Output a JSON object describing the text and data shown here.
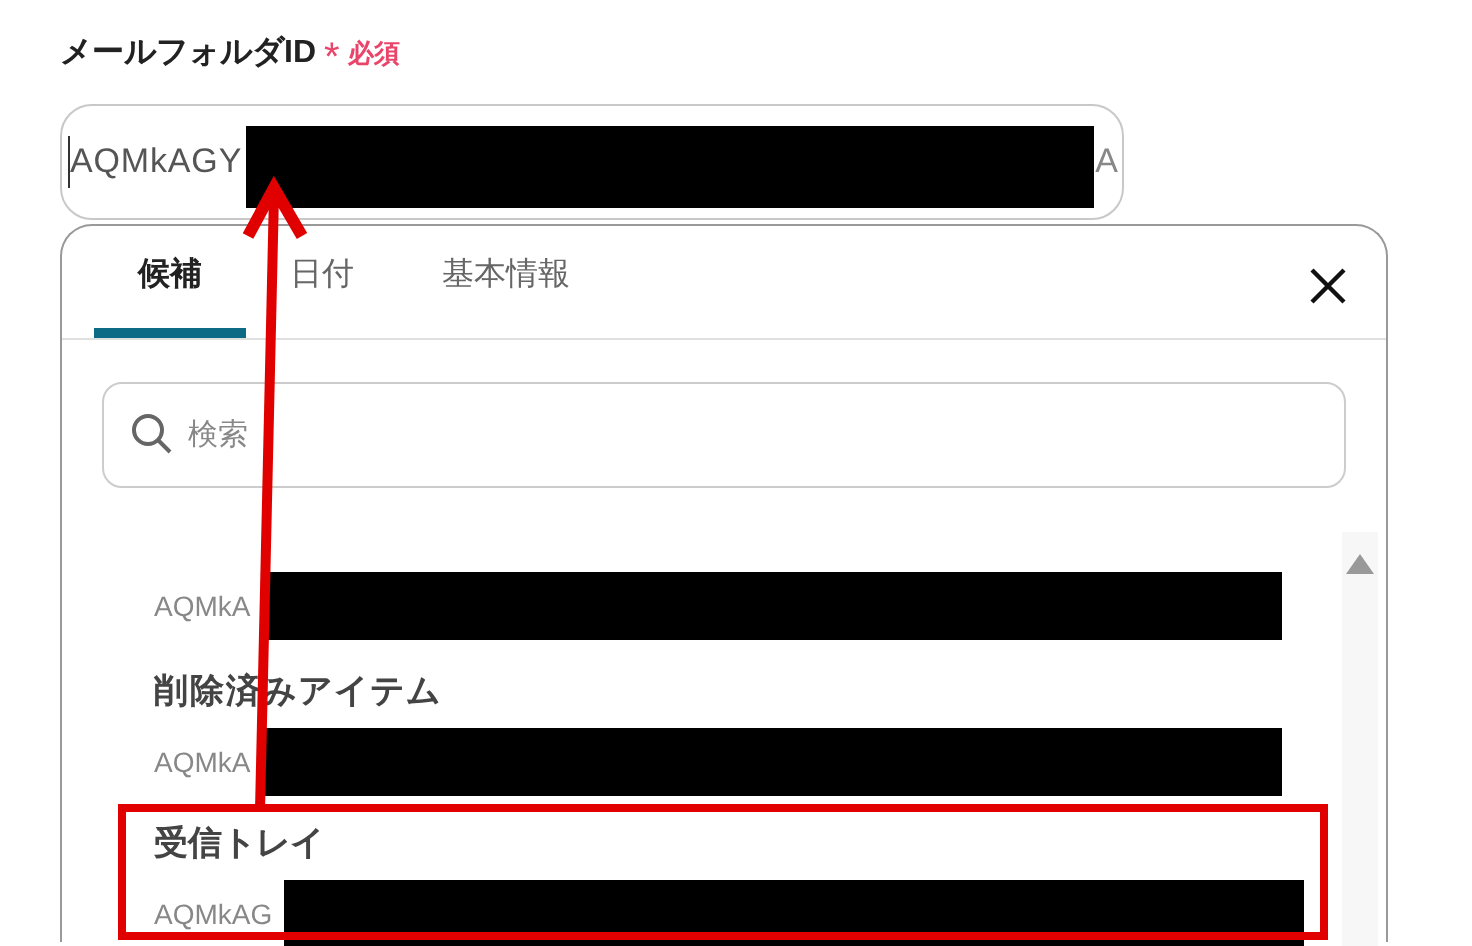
{
  "field": {
    "label": "メールフォルダID",
    "required_mark": "*",
    "required_text": "必須",
    "value_start": "AQMkAGY",
    "value_end": "A",
    "redacted": true
  },
  "dropdown": {
    "tabs": [
      {
        "label": "候補",
        "selected": true
      },
      {
        "label": "日付",
        "selected": false
      },
      {
        "label": "基本情報",
        "selected": false
      }
    ],
    "search": {
      "placeholder": "検索"
    },
    "items": [
      {
        "id": "AQMkA",
        "redacted": true
      },
      {
        "title": "削除済みアイテム",
        "id": "AQMkA",
        "redacted": true
      },
      {
        "title": "受信トレイ",
        "id": "AQMkAG",
        "redacted": true,
        "highlighted": true
      }
    ]
  }
}
